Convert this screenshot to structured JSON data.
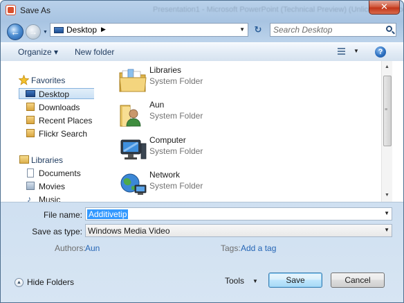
{
  "window": {
    "title": "Save As",
    "background_title": "Presentation1 - Microsoft PowerPoint (Technical Preview) (Unlicensed Product)",
    "close_glyph": "✕"
  },
  "nav": {
    "back_glyph": "←",
    "forward_glyph": "→",
    "address": "Desktop",
    "address_icon": "desktop-icon",
    "search_placeholder": "Search Desktop"
  },
  "commands": {
    "organize": "Organize ▾",
    "new_folder": "New folder",
    "help": "?"
  },
  "sidebar": {
    "favorites": {
      "label": "Favorites",
      "items": [
        {
          "label": "Desktop",
          "icon": "desktop-icon",
          "selected": true
        },
        {
          "label": "Downloads",
          "icon": "downloads-icon"
        },
        {
          "label": "Recent Places",
          "icon": "recent-places-icon"
        },
        {
          "label": "Flickr Search",
          "icon": "flickr-search-icon"
        }
      ]
    },
    "libraries": {
      "label": "Libraries",
      "items": [
        {
          "label": "Documents",
          "icon": "documents-icon"
        },
        {
          "label": "Movies",
          "icon": "movies-icon"
        },
        {
          "label": "Music",
          "icon": "music-icon"
        }
      ]
    }
  },
  "files": [
    {
      "name": "Libraries",
      "type": "System Folder",
      "icon": "libraries-folder-icon"
    },
    {
      "name": "Aun",
      "type": "System Folder",
      "icon": "user-folder-icon"
    },
    {
      "name": "Computer",
      "type": "System Folder",
      "icon": "computer-icon"
    },
    {
      "name": "Network",
      "type": "System Folder",
      "icon": "network-icon"
    }
  ],
  "form": {
    "file_name_label": "File name:",
    "file_name_value": "Additivetip",
    "save_as_type_label": "Save as type:",
    "save_as_type_value": "Windows Media Video",
    "authors_label": "Authors:",
    "authors_value": "Aun",
    "tags_label": "Tags:",
    "tags_value": "Add a tag"
  },
  "footer": {
    "hide_folders": "Hide Folders",
    "tools": "Tools",
    "save": "Save",
    "cancel": "Cancel"
  },
  "colors": {
    "accent": "#3399ff",
    "link": "#2565b5",
    "frame": "#b9d1ea",
    "close": "#c2361a"
  }
}
